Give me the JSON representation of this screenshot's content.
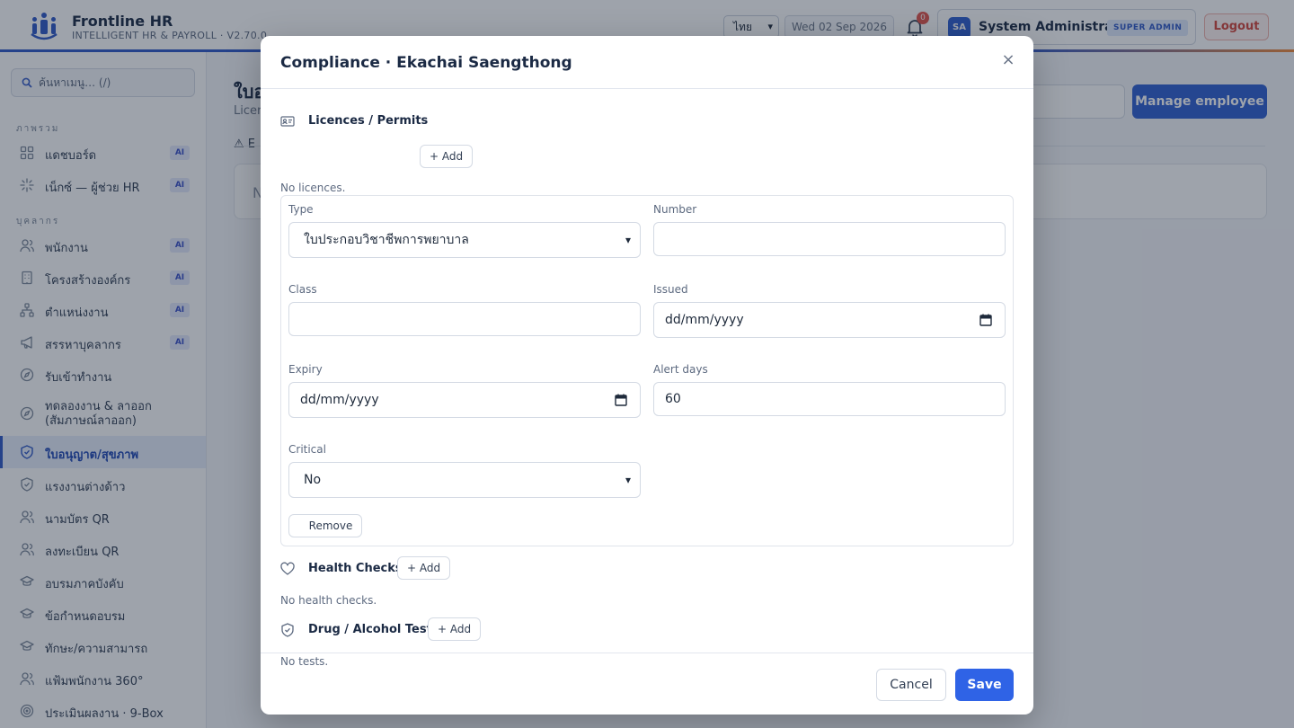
{
  "app": {
    "name": "Frontline HR",
    "subtitle": "INTELLIGENT HR & PAYROLL · V2.70.0"
  },
  "header": {
    "language": "ไทย",
    "date": "Wed 02 Sep 2026",
    "notification_count": "0",
    "avatar_initials": "SA",
    "user_name": "System Administrator",
    "role_badge": "SUPER ADMIN",
    "logout_label": "Logout"
  },
  "sidebar": {
    "search_placeholder": "ค้นหาเมนู… (/)",
    "sections": {
      "overview": "ภาพรวม",
      "people": "บุคลากร"
    },
    "items": [
      {
        "label": "แดชบอร์ด",
        "ai": "AI",
        "icon": "grid-icon"
      },
      {
        "label": "เน็กซ์ — ผู้ช่วย HR",
        "ai": "AI",
        "icon": "sparkle-icon"
      },
      {
        "label": "พนักงาน",
        "ai": "AI",
        "icon": "users-icon"
      },
      {
        "label": "โครงสร้างองค์กร",
        "ai": "AI",
        "icon": "building-icon"
      },
      {
        "label": "ตำแหน่งงาน",
        "ai": "AI",
        "icon": "hierarchy-icon"
      },
      {
        "label": "สรรหาบุคลากร",
        "ai": "AI",
        "icon": "megaphone-icon"
      },
      {
        "label": "รับเข้าทำงาน",
        "icon": "compass-icon"
      },
      {
        "label": "ทดลองงาน & ลาออก (สัมภาษณ์ลาออก)",
        "icon": "compass-icon"
      },
      {
        "label": "ใบอนุญาต/สุขภาพ",
        "icon": "shield-check-icon",
        "active": true
      },
      {
        "label": "แรงงานต่างด้าว",
        "icon": "shield-check-icon"
      },
      {
        "label": "นามบัตร QR",
        "icon": "users-icon"
      },
      {
        "label": "ลงทะเบียน QR",
        "icon": "users-icon"
      },
      {
        "label": "อบรมภาคบังคับ",
        "icon": "graduation-cap-icon"
      },
      {
        "label": "ข้อกำหนดอบรม",
        "icon": "graduation-cap-icon"
      },
      {
        "label": "ทักษะ/ความสามารถ",
        "icon": "graduation-cap-icon"
      },
      {
        "label": "แฟ้มพนักงาน 360°",
        "icon": "users-icon"
      },
      {
        "label": "ประเมินผลงาน · 9-Box",
        "icon": "target-icon"
      }
    ]
  },
  "main": {
    "title": "ใบอ",
    "subtitle": "Licer",
    "warning_text": "E",
    "card_text": "N",
    "manage_button": "Manage employee"
  },
  "modal": {
    "title": "Compliance · Ekachai Saengthong",
    "close_label": "×",
    "licences": {
      "title": "Licences / Permits",
      "add_label": "+ Add",
      "empty": "No licences.",
      "fields": {
        "type_label": "Type",
        "type_value": "ใบประกอบวิชาชีพการพยาบาล",
        "number_label": "Number",
        "number_value": "",
        "class_label": "Class",
        "class_value": "",
        "issued_label": "Issued",
        "issued_value": "dd/mm/yyyy",
        "expiry_label": "Expiry",
        "expiry_value": "dd/mm/yyyy",
        "alert_label": "Alert days",
        "alert_value": "60",
        "critical_label": "Critical",
        "critical_value": "No"
      },
      "remove_label": "Remove"
    },
    "health": {
      "title": "Health Checks",
      "add_label": "+ Add",
      "empty": "No health checks."
    },
    "drug": {
      "title": "Drug / Alcohol Tests",
      "add_label": "+ Add",
      "empty": "No tests."
    },
    "cancel_label": "Cancel",
    "save_label": "Save"
  },
  "colors": {
    "primary": "#2f5fd0",
    "save": "#2f63e6",
    "logout": "#d2453b",
    "active_nav_bg": "#e7eefc"
  }
}
